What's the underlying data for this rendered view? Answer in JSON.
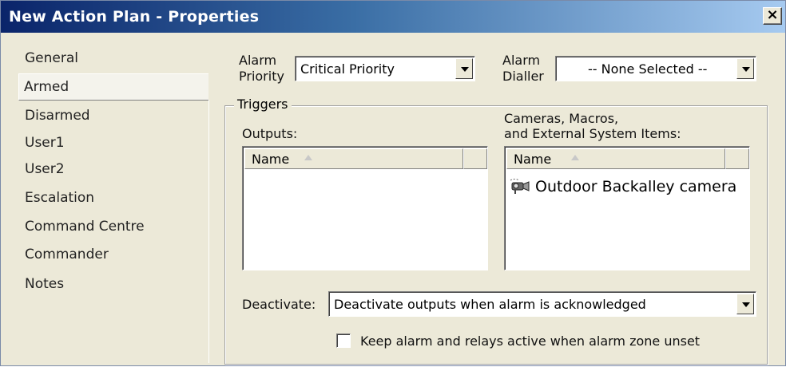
{
  "window": {
    "title": "New Action Plan - Properties",
    "close_label": "×"
  },
  "sidebar": {
    "items": [
      {
        "label": "General"
      },
      {
        "label": "Armed"
      },
      {
        "label": "Disarmed"
      },
      {
        "label": "User1"
      },
      {
        "label": "User2"
      },
      {
        "label": "Escalation"
      },
      {
        "label": "Command Centre"
      },
      {
        "label": "Commander"
      },
      {
        "label": "Notes"
      }
    ],
    "selected": "Armed"
  },
  "alarm_priority": {
    "label_line1": "Alarm",
    "label_line2": "Priority",
    "value": "Critical Priority"
  },
  "alarm_dialler": {
    "label_line1": "Alarm",
    "label_line2": "Dialler",
    "value": "-- None Selected --"
  },
  "triggers": {
    "legend": "Triggers",
    "outputs": {
      "label": "Outputs:",
      "column_header": "Name",
      "items": []
    },
    "cameras": {
      "label_line1": "Cameras, Macros,",
      "label_line2": "and External System Items:",
      "column_header": "Name",
      "items": [
        {
          "label": "Outdoor Backalley camera",
          "icon": "camera-icon"
        }
      ]
    }
  },
  "deactivate": {
    "label": "Deactivate:",
    "value": "Deactivate outputs when alarm is acknowledged"
  },
  "keep_active": {
    "label": "Keep alarm and relays active when alarm zone unset",
    "checked": false
  }
}
